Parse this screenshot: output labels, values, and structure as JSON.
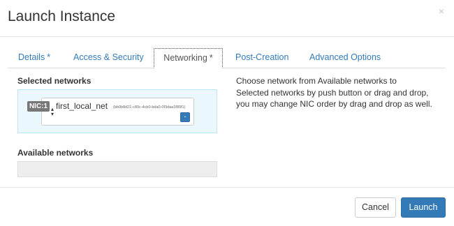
{
  "dialog": {
    "title": "Launch Instance",
    "close_glyph": "×"
  },
  "tabs": [
    {
      "label": "Details",
      "required": "*",
      "active": false
    },
    {
      "label": "Access & Security",
      "required": "",
      "active": false
    },
    {
      "label": "Networking",
      "required": "*",
      "active": true
    },
    {
      "label": "Post-Creation",
      "required": "",
      "active": false
    },
    {
      "label": "Advanced Options",
      "required": "",
      "active": false
    }
  ],
  "networking": {
    "selected_label": "Selected networks",
    "selected": [
      {
        "nic": "NIC:1",
        "name": "first_local_net",
        "id": "(bb0b8d21-c80c-4cb0-bda0-0f3daa1f80f1)",
        "remove_icon": "minus-icon"
      }
    ],
    "available_label": "Available networks",
    "help_lines": [
      "Choose network from Available networks to",
      "Selected networks by push button or drag and drop,",
      "you may change NIC order by drag and drop as well."
    ]
  },
  "footer": {
    "cancel_label": "Cancel",
    "launch_label": "Launch"
  },
  "colors": {
    "primary": "#337ab7",
    "selected_bg": "#eaf7fc",
    "badge": "#777777"
  }
}
